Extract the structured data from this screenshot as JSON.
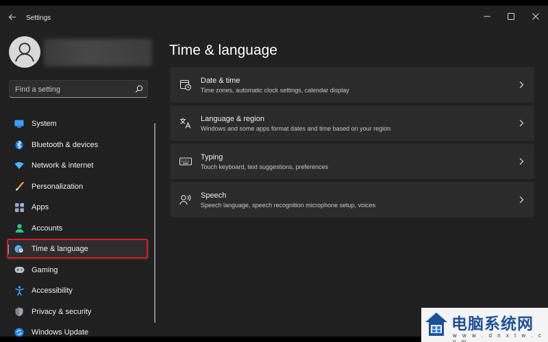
{
  "window": {
    "title": "Settings"
  },
  "search": {
    "placeholder": "Find a setting"
  },
  "sidebar": {
    "items": [
      {
        "label": "System",
        "icon": "system-monitor-icon"
      },
      {
        "label": "Bluetooth & devices",
        "icon": "bluetooth-icon"
      },
      {
        "label": "Network & internet",
        "icon": "wifi-icon"
      },
      {
        "label": "Personalization",
        "icon": "brush-icon"
      },
      {
        "label": "Apps",
        "icon": "apps-icon"
      },
      {
        "label": "Accounts",
        "icon": "person-icon"
      },
      {
        "label": "Time & language",
        "icon": "globe-clock-icon",
        "selected": true
      },
      {
        "label": "Gaming",
        "icon": "gamepad-icon"
      },
      {
        "label": "Accessibility",
        "icon": "accessibility-icon"
      },
      {
        "label": "Privacy & security",
        "icon": "shield-icon"
      },
      {
        "label": "Windows Update",
        "icon": "update-icon"
      }
    ]
  },
  "main": {
    "title": "Time & language",
    "cards": [
      {
        "title": "Date & time",
        "description": "Time zones, automatic clock settings, calendar display",
        "icon": "calendar-clock-icon"
      },
      {
        "title": "Language & region",
        "description": "Windows and some apps format dates and time based on your region",
        "icon": "language-icon"
      },
      {
        "title": "Typing",
        "description": "Touch keyboard, text suggestions, preferences",
        "icon": "keyboard-icon"
      },
      {
        "title": "Speech",
        "description": "Speech language, speech recognition microphone setup, voices",
        "icon": "speech-icon"
      }
    ]
  },
  "watermark": {
    "name": "电脑系统网",
    "domain": "w w w . d n x t w . c o m"
  },
  "colors": {
    "window_bg": "#202020",
    "card_bg": "#2b2b2b",
    "accent": "#4cc2ff",
    "highlight_box": "#e01a22"
  }
}
